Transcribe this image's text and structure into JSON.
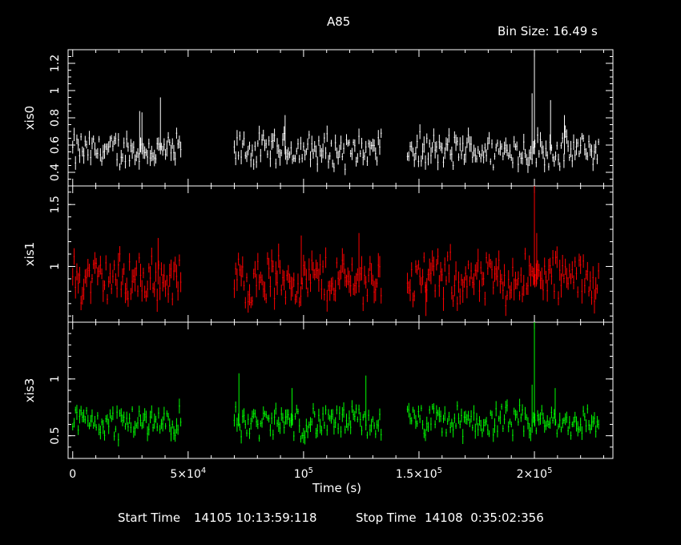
{
  "header": {
    "title": "A85",
    "bin_size": "Bin Size: 16.49 s"
  },
  "footer": {
    "start_label": "Start Time",
    "start_value": "14105 10:13:59:118",
    "stop_label": "Stop Time",
    "stop_value": "14108  0:35:02:356"
  },
  "colors": {
    "background": "#000000",
    "axes": "#ffffff",
    "xis0": "#ffffff",
    "xis1": "#ff0000",
    "xis3": "#00ff00"
  },
  "chart_data": {
    "type": "line",
    "title": "A85",
    "subtitle": "Bin Size: 16.49 s",
    "xlabel": "Time (s)",
    "x_tick_labels": [
      "0",
      "5×10^4",
      "10^5",
      "1.5×10^5",
      "2×10^5"
    ],
    "x_ticks": [
      0,
      50000,
      100000,
      150000,
      200000
    ],
    "xlim": [
      -2000,
      234000
    ],
    "segments": [
      [
        0,
        47000
      ],
      [
        70000,
        134000
      ],
      [
        145000,
        228000
      ]
    ],
    "grid": false,
    "panels": [
      {
        "name": "xis0",
        "ylabel": "xis0",
        "color": "#ffffff",
        "ylim": [
          0.3,
          1.3
        ],
        "yticks": [
          0.4,
          0.6,
          0.8,
          1,
          1.2
        ],
        "ytick_labels": [
          "0.4",
          "0.6",
          "0.8",
          "1",
          "1.2"
        ],
        "mean": 0.56,
        "spikes": [
          {
            "x": 29000,
            "y": 0.85
          },
          {
            "x": 30000,
            "y": 0.84
          },
          {
            "x": 38000,
            "y": 0.95
          },
          {
            "x": 92000,
            "y": 0.82
          },
          {
            "x": 200000,
            "y": 1.28
          },
          {
            "x": 199000,
            "y": 0.98
          },
          {
            "x": 207000,
            "y": 0.93
          },
          {
            "x": 213000,
            "y": 0.82
          }
        ]
      },
      {
        "name": "xis1",
        "ylabel": "xis1",
        "color": "#ff0000",
        "ylim": [
          0.55,
          1.65
        ],
        "yticks": [
          1,
          1.5
        ],
        "ytick_labels": [
          "1",
          "1.5"
        ],
        "mean": 0.9,
        "spikes": [
          {
            "x": 37000,
            "y": 1.23
          },
          {
            "x": 99000,
            "y": 1.25
          },
          {
            "x": 124000,
            "y": 1.27
          },
          {
            "x": 200000,
            "y": 1.65
          },
          {
            "x": 201000,
            "y": 1.27
          },
          {
            "x": 153000,
            "y": 0.6
          }
        ]
      },
      {
        "name": "xis3",
        "ylabel": "xis3",
        "color": "#00ff00",
        "ylim": [
          0.3,
          1.5
        ],
        "yticks": [
          0.5,
          1
        ],
        "ytick_labels": [
          "0.5",
          "1"
        ],
        "mean": 0.62,
        "spikes": [
          {
            "x": 72000,
            "y": 1.05
          },
          {
            "x": 127000,
            "y": 1.03
          },
          {
            "x": 200000,
            "y": 1.5
          },
          {
            "x": 199000,
            "y": 0.95
          },
          {
            "x": 209000,
            "y": 0.92
          },
          {
            "x": 95000,
            "y": 0.92
          }
        ]
      }
    ]
  }
}
